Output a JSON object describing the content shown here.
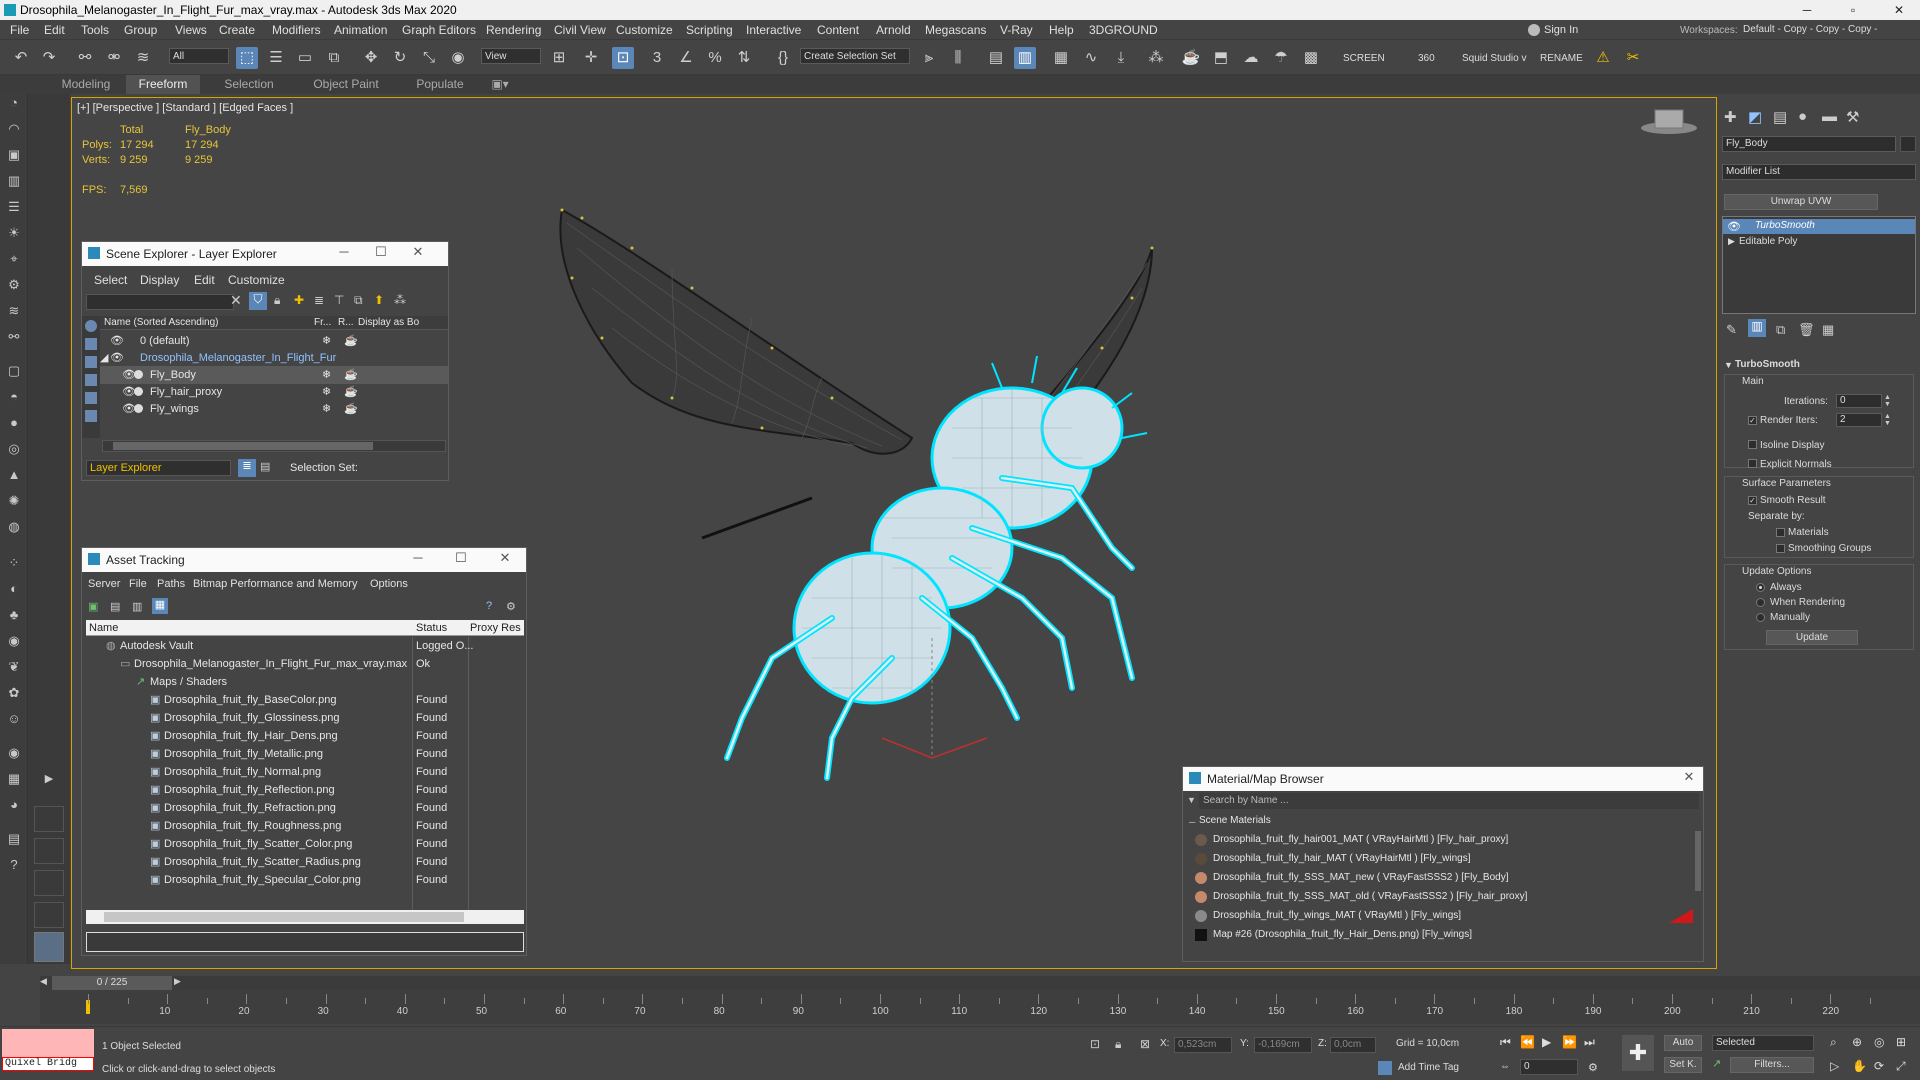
{
  "window": {
    "title": "Drosophila_Melanogaster_In_Flight_Fur_max_vray.max - Autodesk 3ds Max 2020",
    "minimize": "─",
    "maximize": "▫",
    "close": "✕"
  },
  "menubar": {
    "items": [
      "File",
      "Edit",
      "Tools",
      "Group",
      "Views",
      "Create",
      "Modifiers",
      "Animation",
      "Graph Editors",
      "Rendering",
      "Civil View",
      "Customize",
      "Scripting",
      "Interactive",
      "Content",
      "Arnold",
      "Megascans",
      "V-Ray",
      "Help",
      "3DGROUND"
    ],
    "sign_in": "Sign In",
    "workspaces_label": "Workspaces:",
    "workspaces_value": "Default - Copy - Copy - Copy - Copy"
  },
  "toolbar": {
    "filter_value": "All",
    "view_value": "View",
    "selection_set": "Create Selection Set",
    "screen": "SCREEN",
    "value_360": "360",
    "squid": "Squid Studio v",
    "rename": "RENAME"
  },
  "ribbon": {
    "tabs": [
      "Modeling",
      "Freeform",
      "Selection",
      "Object Paint",
      "Populate"
    ],
    "active": "Freeform"
  },
  "viewport": {
    "label": "[+] [Perspective ] [Standard ] [Edged Faces ]",
    "stats": {
      "col_total": "Total",
      "col_obj": "Fly_Body",
      "polys_label": "Polys:",
      "polys_total": "17 294",
      "polys_obj": "17 294",
      "verts_label": "Verts:",
      "verts_total": "9 259",
      "verts_obj": "9 259",
      "fps_label": "FPS:",
      "fps_value": "7,569"
    }
  },
  "scene_explorer": {
    "title": "Scene Explorer - Layer Explorer",
    "menu": [
      "Select",
      "Display",
      "Edit",
      "Customize"
    ],
    "columns": [
      "Name (Sorted Ascending)",
      "Fr...",
      "R...",
      "Display as Bo"
    ],
    "rows": [
      {
        "name": "0 (default)"
      },
      {
        "name": "Drosophila_Melanogaster_In_Flight_Fur"
      },
      {
        "name": "Fly_Body"
      },
      {
        "name": "Fly_hair_proxy"
      },
      {
        "name": "Fly_wings"
      }
    ],
    "footer_dropdown": "Layer Explorer",
    "selection_set_label": "Selection Set:"
  },
  "asset_tracking": {
    "title": "Asset Tracking",
    "menu": [
      "Server",
      "File",
      "Paths",
      "Bitmap Performance and Memory",
      "Options"
    ],
    "columns": [
      "Name",
      "Status",
      "Proxy Res"
    ],
    "rows": [
      {
        "name": "Autodesk Vault",
        "status": "Logged O..."
      },
      {
        "name": "Drosophila_Melanogaster_In_Flight_Fur_max_vray.max",
        "status": "Ok"
      },
      {
        "name": "Maps / Shaders",
        "status": ""
      },
      {
        "name": "Drosophila_fruit_fly_BaseColor.png",
        "status": "Found"
      },
      {
        "name": "Drosophila_fruit_fly_Glossiness.png",
        "status": "Found"
      },
      {
        "name": "Drosophila_fruit_fly_Hair_Dens.png",
        "status": "Found"
      },
      {
        "name": "Drosophila_fruit_fly_Metallic.png",
        "status": "Found"
      },
      {
        "name": "Drosophila_fruit_fly_Normal.png",
        "status": "Found"
      },
      {
        "name": "Drosophila_fruit_fly_Reflection.png",
        "status": "Found"
      },
      {
        "name": "Drosophila_fruit_fly_Refraction.png",
        "status": "Found"
      },
      {
        "name": "Drosophila_fruit_fly_Roughness.png",
        "status": "Found"
      },
      {
        "name": "Drosophila_fruit_fly_Scatter_Color.png",
        "status": "Found"
      },
      {
        "name": "Drosophila_fruit_fly_Scatter_Radius.png",
        "status": "Found"
      },
      {
        "name": "Drosophila_fruit_fly_Specular_Color.png",
        "status": "Found"
      }
    ]
  },
  "material_browser": {
    "title": "Material/Map Browser",
    "search_placeholder": "Search by Name ...",
    "section": "Scene Materials",
    "items": [
      "Drosophila_fruit_fly_hair001_MAT  ( VRayHairMtl )  [Fly_hair_proxy]",
      "Drosophila_fruit_fly_hair_MAT  ( VRayHairMtl )  [Fly_wings]",
      "Drosophila_fruit_fly_SSS_MAT_new  ( VRayFastSSS2 )  [Fly_Body]",
      "Drosophila_fruit_fly_SSS_MAT_old  ( VRayFastSSS2 )  [Fly_hair_proxy]",
      "Drosophila_fruit_fly_wings_MAT  ( VRayMtl )  [Fly_wings]",
      "Map #26 (Drosophila_fruit_fly_Hair_Dens.png)  [Fly_wings]"
    ]
  },
  "command_panel": {
    "object_name": "Fly_Body",
    "modifier_list": "Modifier List",
    "unwrap_button": "Unwrap UVW",
    "stack": [
      "TurboSmooth",
      "Editable Poly"
    ],
    "rollout_title": "TurboSmooth",
    "main_label": "Main",
    "iterations_label": "Iterations:",
    "iterations_value": "0",
    "render_iters_label": "Render Iters:",
    "render_iters_value": "2",
    "isoline": "Isoline Display",
    "explicit_normals": "Explicit Normals",
    "surface_params": "Surface Parameters",
    "smooth_result": "Smooth Result",
    "separate_by": "Separate by:",
    "materials": "Materials",
    "smoothing_groups": "Smoothing Groups",
    "update_options": "Update Options",
    "always": "Always",
    "when_rendering": "When Rendering",
    "manually": "Manually",
    "update_button": "Update"
  },
  "timeline": {
    "frame_display": "0 / 225",
    "ticks": [
      "10",
      "20",
      "30",
      "40",
      "50",
      "60",
      "70",
      "80",
      "90",
      "100",
      "110",
      "120",
      "130",
      "140",
      "150",
      "160",
      "170",
      "180",
      "190",
      "200",
      "210",
      "220"
    ]
  },
  "statusbar": {
    "bridge_label": "Quixel Bridg",
    "selected": "1 Object Selected",
    "hint": "Click or click-and-drag to select objects",
    "x_label": "X:",
    "x_value": "0,523cm",
    "y_label": "Y:",
    "y_value": "-0,169cm",
    "z_label": "Z:",
    "z_value": "0,0cm",
    "grid": "Grid = 10,0cm",
    "add_time_tag": "Add Time Tag",
    "auto": "Auto",
    "set_k": "Set K.",
    "selected_dropdown": "Selected",
    "filters": "Filters...",
    "frame_field": "0"
  },
  "colors": {
    "accent": "#5b87b8",
    "viewport_border": "#d9a400",
    "stats_text": "#e6c43a",
    "selection_wire": "#00e5ff"
  }
}
